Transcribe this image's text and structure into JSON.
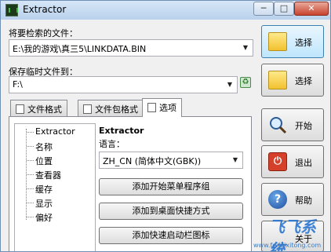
{
  "window": {
    "title": "Extractor"
  },
  "titlebar": {
    "minimize": "─",
    "maximize": "□",
    "close": "✕"
  },
  "source": {
    "label": "将要检索的文件：",
    "value": "E:\\我的游戏\\真三5\\LINKDATA.BIN"
  },
  "temp": {
    "label": "保存临时文件到：",
    "value": "F:\\"
  },
  "side_buttons": {
    "select1": "选择",
    "select2": "选择",
    "start": "开始",
    "exit": "退出",
    "help": "帮助",
    "about": "关于"
  },
  "tabs": [
    {
      "label": "文件格式"
    },
    {
      "label": "文件包格式"
    },
    {
      "label": "选项"
    }
  ],
  "tree": [
    "Extractor",
    "名称",
    "位置",
    "查看器",
    "缓存",
    "显示",
    "偏好"
  ],
  "options": {
    "group_title": "Extractor",
    "language_label": "语言：",
    "language_value": "ZH_CN (简体中文(GBK))",
    "buttons": [
      "添加开始菜单程序组",
      "添加到桌面快捷方式",
      "添加快速启动栏图标"
    ]
  },
  "watermark": {
    "logo": "飞飞系统",
    "url": "www.feifeixitong.com"
  },
  "icons": {
    "app": "extractor-app-icon",
    "select1": "folder-open-icon",
    "select2": "folder-icon",
    "start": "magnifier-icon",
    "exit": "exit-icon",
    "help": "help-icon",
    "recycle": "recycle-icon"
  },
  "colors": {
    "accent": "#3c7fb1",
    "exit": "#d4402a",
    "help": "#1d4e9e"
  }
}
